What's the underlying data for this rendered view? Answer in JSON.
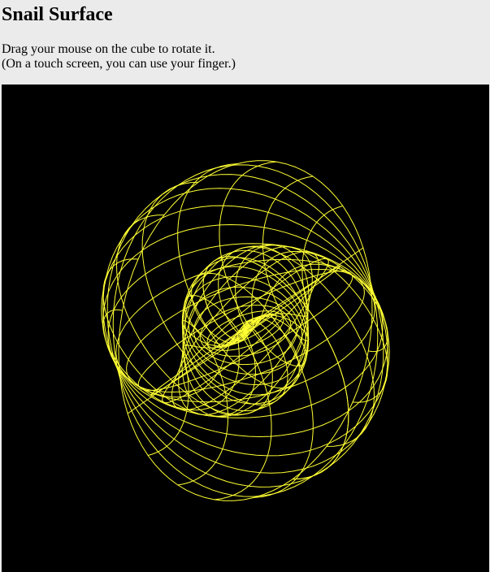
{
  "page": {
    "title": "Snail Surface",
    "instruction_line1": "Drag your mouse on the cube to rotate it.",
    "instruction_line2": "(On a touch screen, you can use your finger.)"
  },
  "canvas": {
    "background": "#000000",
    "wire_color": "#ffff33"
  }
}
